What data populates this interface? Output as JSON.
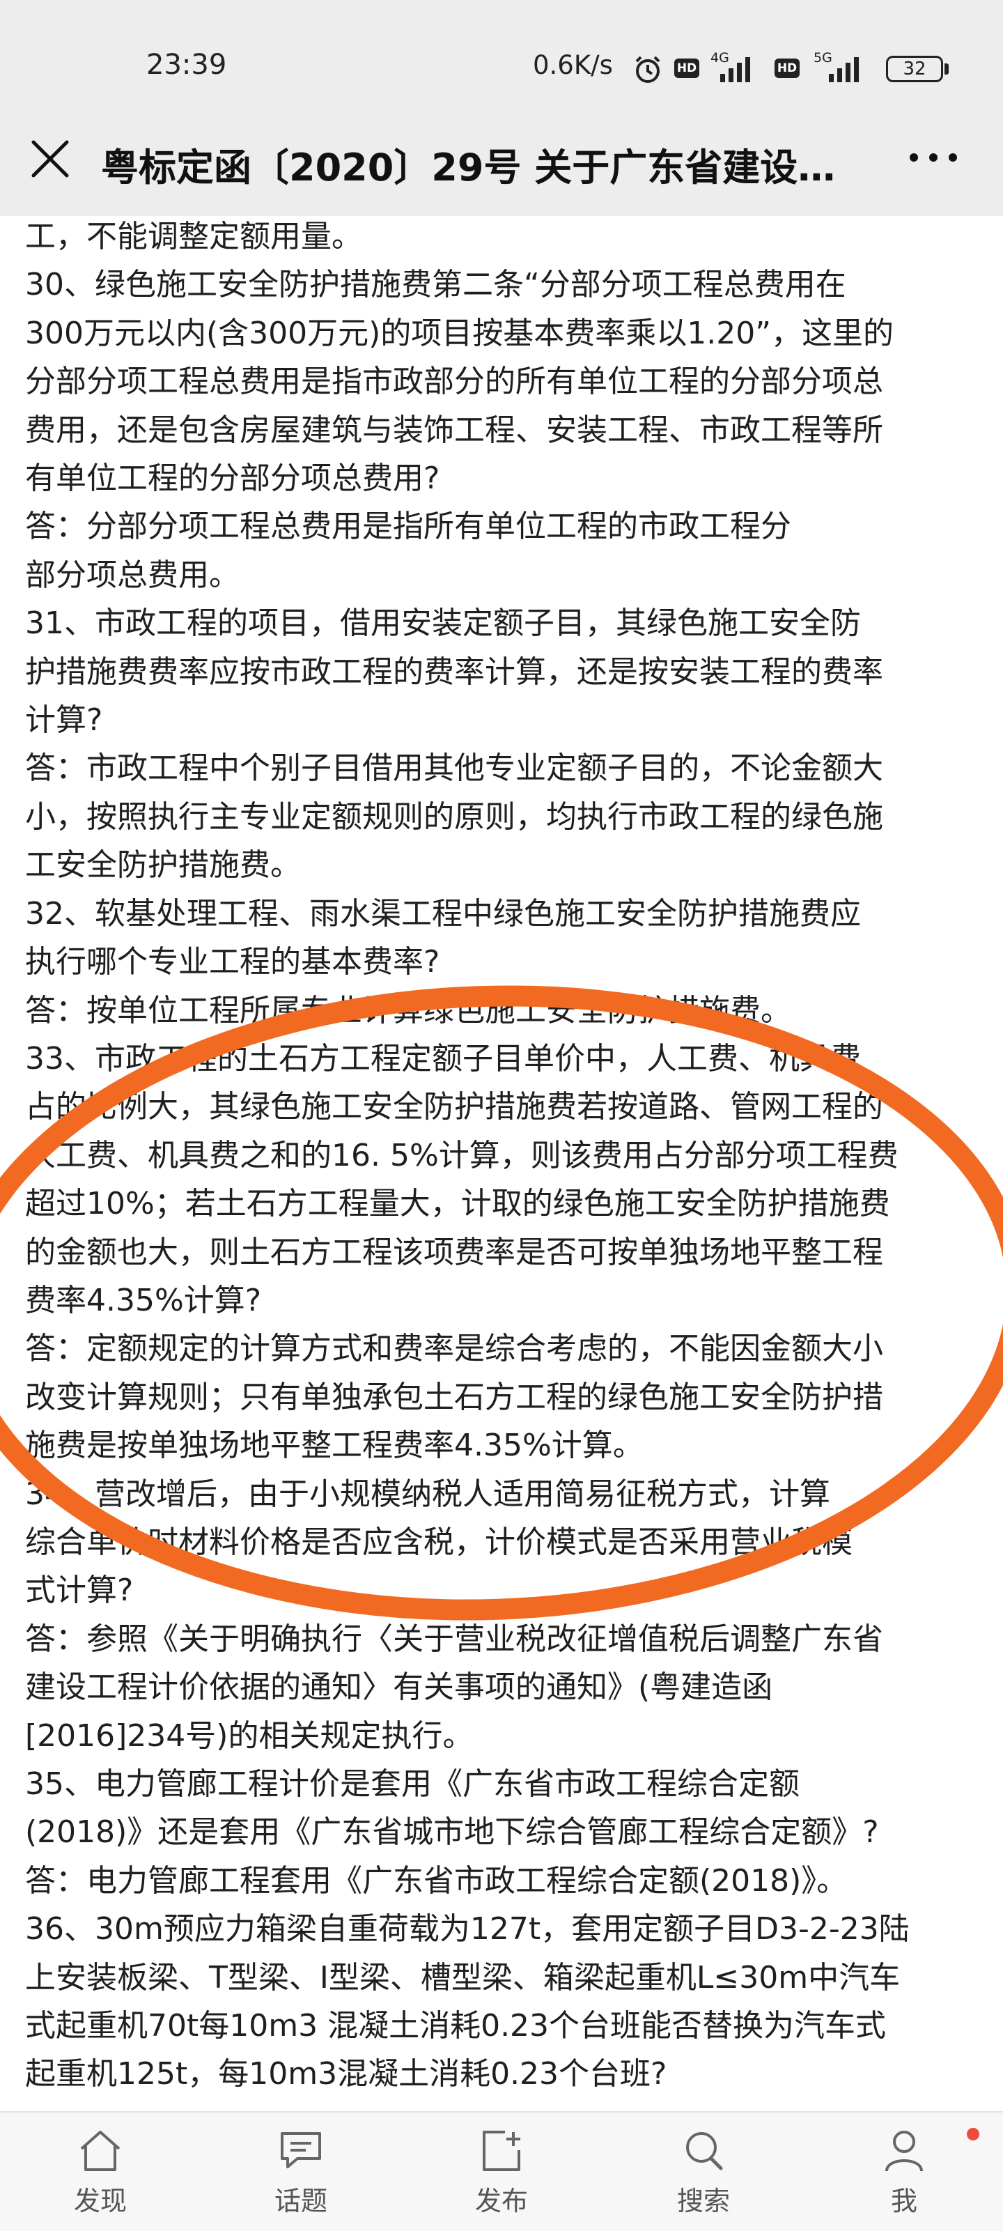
{
  "status_bar": {
    "time": "23:39",
    "net_speed": "0.6K/s",
    "net1": "4G",
    "net2": "5G",
    "hd1": "HD",
    "hd2": "HD",
    "battery": "32"
  },
  "header": {
    "title": "粤标定函〔2020〕29号 关于广东省建设…",
    "close_icon": "close-icon",
    "more_icon": "more-icon"
  },
  "article": {
    "lines": [
      "工，不能调整定额用量。",
      "30、绿色施工安全防护措施费第二条“分部分项工程总费用在",
      "300万元以内(含300万元)的项目按基本费率乘以1.20”，这里的",
      "分部分项工程总费用是指市政部分的所有单位工程的分部分项总",
      "费用，还是包含房屋建筑与装饰工程、安装工程、市政工程等所",
      "有单位工程的分部分项总费用?",
      "答：分部分项工程总费用是指所有单位工程的市政工程分",
      "部分项总费用。",
      "31、市政工程的项目，借用安装定额子目，其绿色施工安全防",
      "护措施费费率应按市政工程的费率计算，还是按安装工程的费率",
      "计算?",
      "答：市政工程中个别子目借用其他专业定额子目的，不论金额大",
      "小，按照执行主专业定额规则的原则，均执行市政工程的绿色施",
      "工安全防护措施费。",
      "32、软基处理工程、雨水渠工程中绿色施工安全防护措施费应",
      "执行哪个专业工程的基本费率?",
      "答：按单位工程所属专业计算绿色施工安全防护措施费。",
      "33、市政工程的土石方工程定额子目单价中，人工费、机具费",
      "占的比例大，其绿色施工安全防护措施费若按道路、管网工程的",
      "人工费、机具费之和的16. 5%计算，则该费用占分部分项工程费",
      "超过10%；若土石方工程量大，计取的绿色施工安全防护措施费",
      "的金额也大，则土石方工程该项费率是否可按单独场地平整工程",
      "费率4.35%计算?",
      "答：定额规定的计算方式和费率是综合考虑的，不能因金额大小",
      "改变计算规则；只有单独承包土石方工程的绿色施工安全防护措",
      "施费是按单独场地平整工程费率4.35%计算。",
      "34、营改增后，由于小规模纳税人适用简易征税方式，计算",
      "综合单价时材料价格是否应含税，计价模式是否采用营业税模",
      "式计算?",
      "答：参照《关于明确执行〈关于营业税改征增值税后调整广东省",
      "建设工程计价依据的通知〉有关事项的通知》(粤建造函",
      "[2016]234号)的相关规定执行。",
      "35、电力管廊工程计价是套用《广东省市政工程综合定额",
      "(2018)》还是套用《广东省城市地下综合管廊工程综合定额》?",
      "答：电力管廊工程套用《广东省市政工程综合定额(2018)》。",
      "36、30m预应力箱梁自重荷载为127t，套用定额子目D3-2-23陆",
      "上安装板梁、T型梁、I型梁、槽型梁、箱梁起重机L≤30m中汽车",
      "式起重机70t每10m3 混凝土消耗0.23个台班能否替换为汽车式",
      "起重机125t，每10m3混凝土消耗0.23个台班?"
    ]
  },
  "annotation": {
    "shape": "ellipse",
    "color": "#f26a21"
  },
  "bottom_nav": {
    "items": [
      {
        "label": "发现",
        "icon": "home-icon"
      },
      {
        "label": "话题",
        "icon": "chat-icon"
      },
      {
        "label": "发布",
        "icon": "compose-icon"
      },
      {
        "label": "搜索",
        "icon": "search-icon"
      },
      {
        "label": "我",
        "icon": "user-icon"
      }
    ],
    "badge_color": "#f04a3a"
  }
}
